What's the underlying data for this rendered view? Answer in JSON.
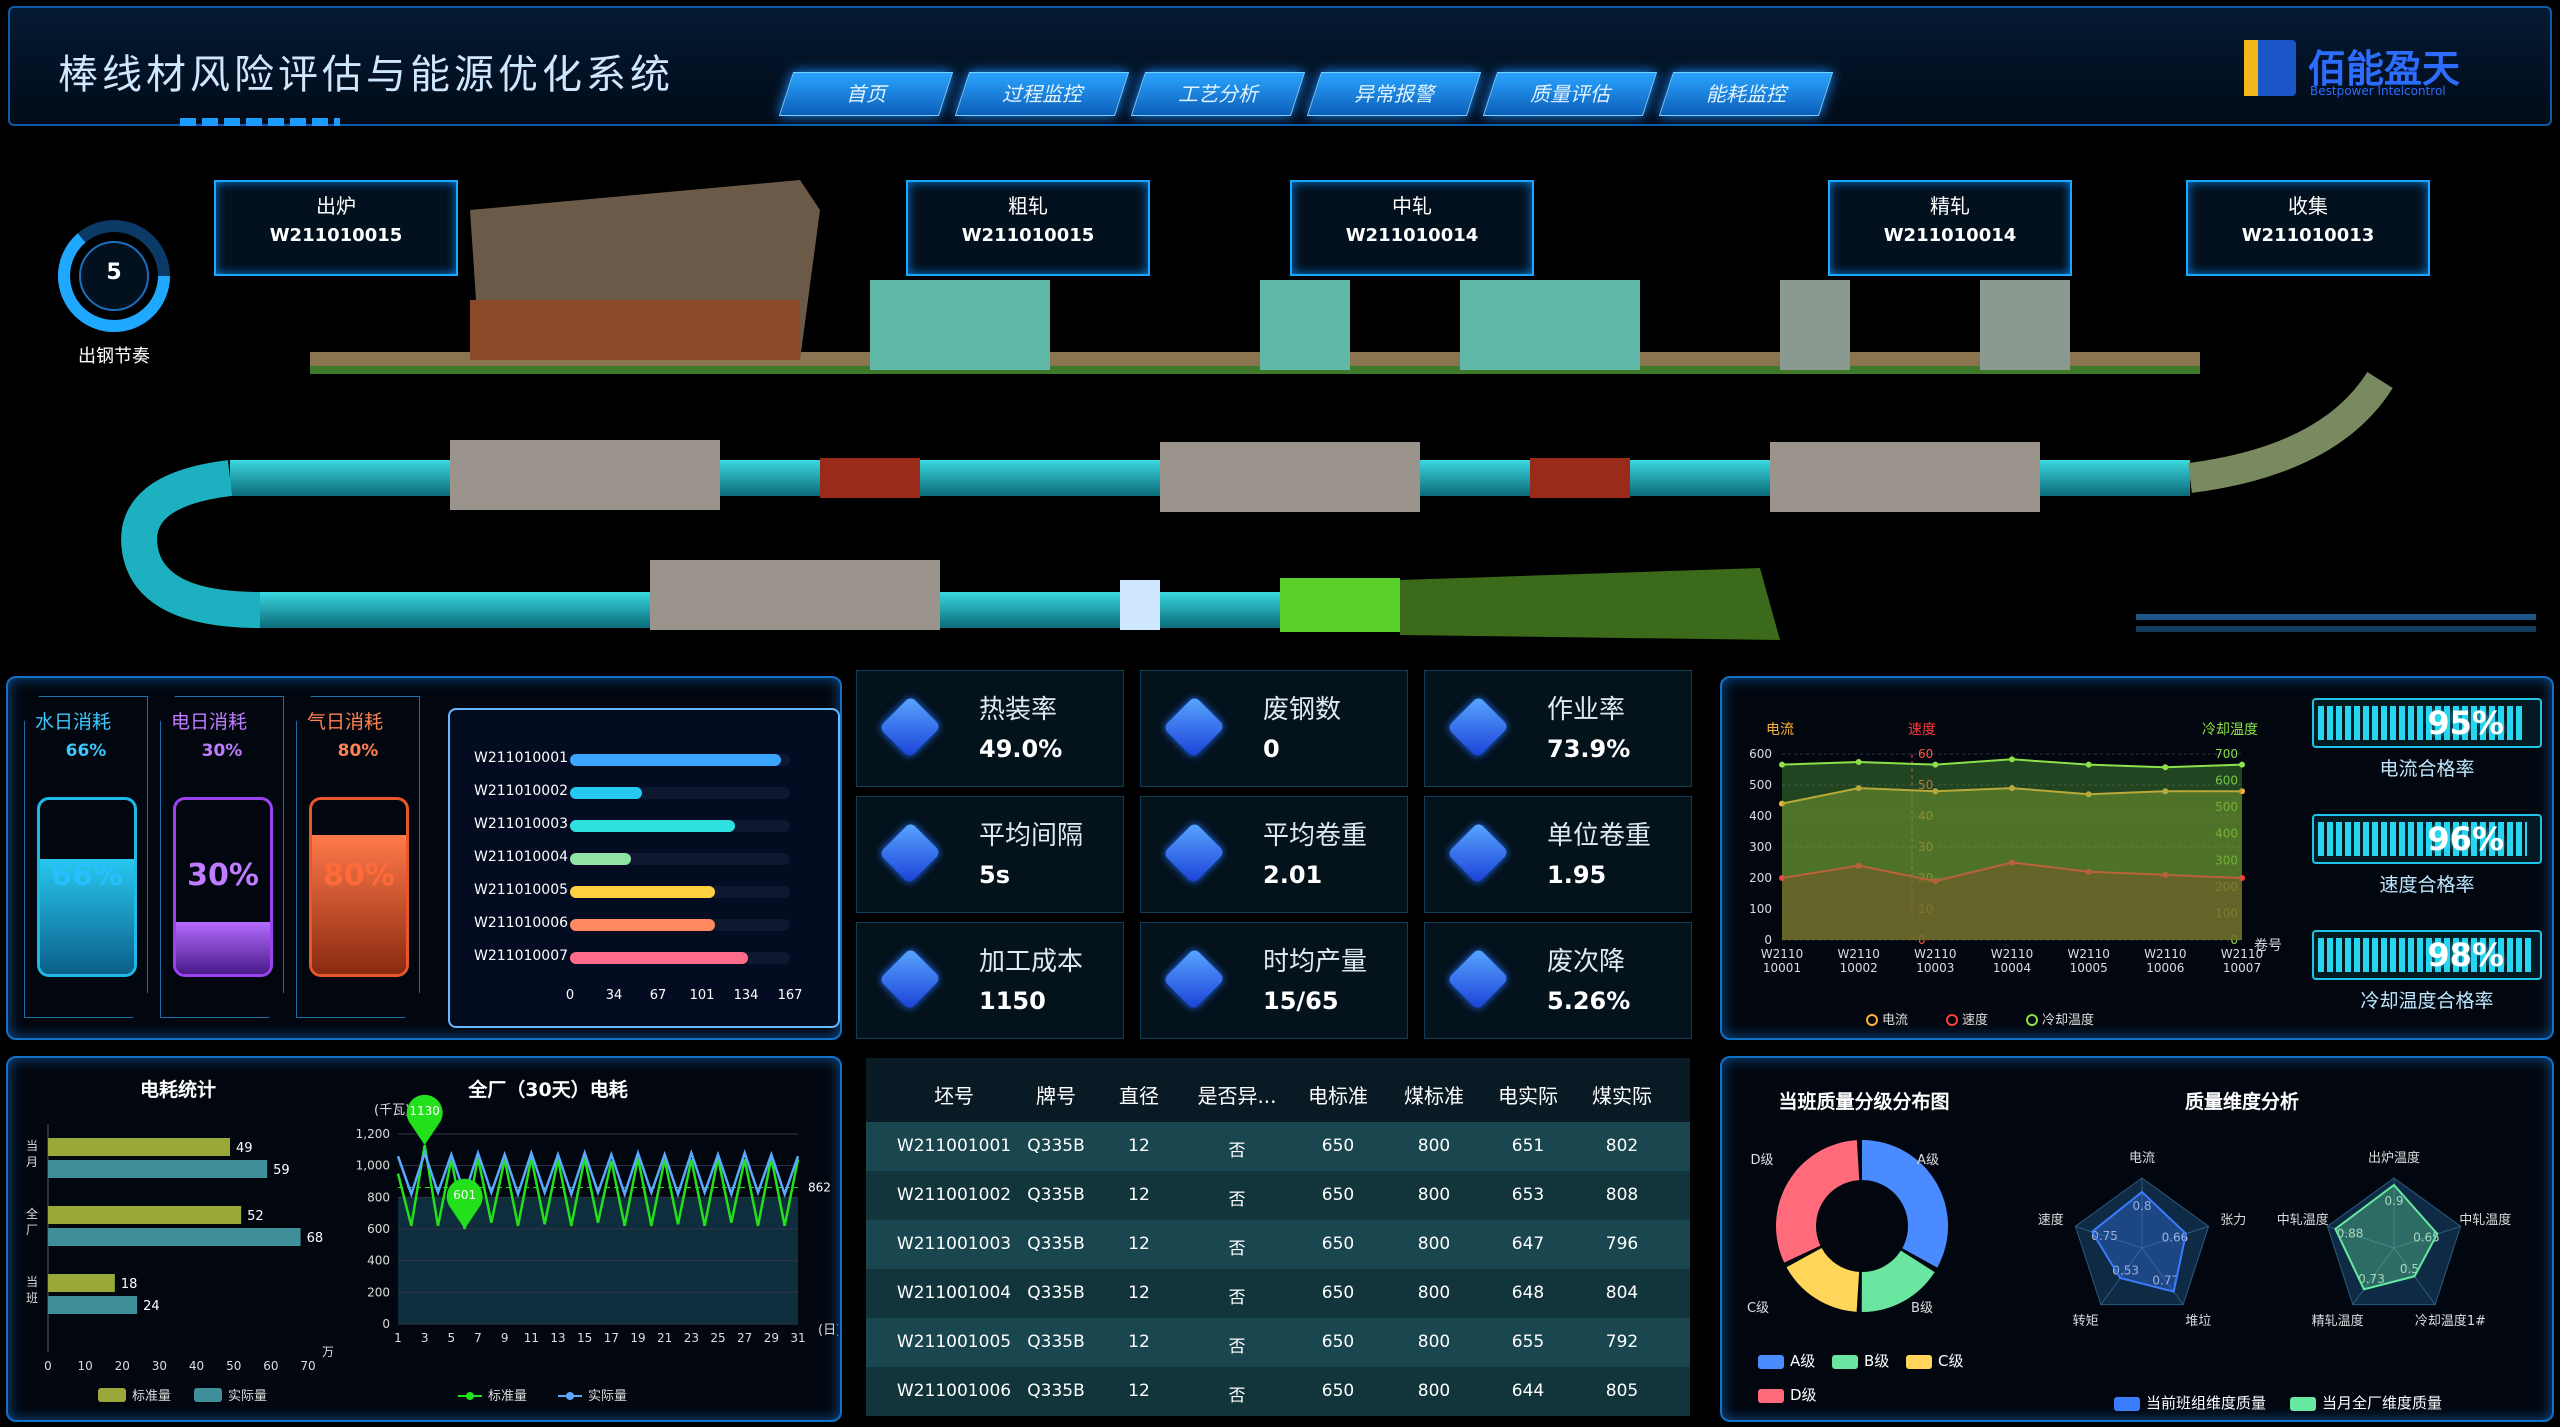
{
  "header": {
    "title": "棒线材风险评估与能源优化系统",
    "nav": [
      "首页",
      "过程监控",
      "工艺分析",
      "异常报警",
      "质量评估",
      "能耗监控"
    ],
    "logo_name": "佰能盈天",
    "logo_sub": "Bestpower Intelcontrol"
  },
  "rhythm": {
    "value": "5",
    "label": "出钢节奏"
  },
  "stations": [
    {
      "name": "出炉",
      "code": "W211010015"
    },
    {
      "name": "粗轧",
      "code": "W211010015"
    },
    {
      "name": "中轧",
      "code": "W211010014"
    },
    {
      "name": "精轧",
      "code": "W211010014"
    },
    {
      "name": "收集",
      "code": "W211010013"
    }
  ],
  "consumption": [
    {
      "title": "水日消耗",
      "pct": "66%",
      "fraction": 0.66,
      "color": "#20b8e6"
    },
    {
      "title": "电日消耗",
      "pct": "30%",
      "fraction": 0.3,
      "color": "#9b42f0"
    },
    {
      "title": "气日消耗",
      "pct": "80%",
      "fraction": 0.8,
      "color": "#e6572c"
    }
  ],
  "billets": {
    "items": [
      {
        "code": "W211010001",
        "value": 160,
        "color": "#3aa6ff"
      },
      {
        "code": "W211010002",
        "value": 55,
        "color": "#24c8f0"
      },
      {
        "code": "W211010003",
        "value": 125,
        "color": "#2ee0e0"
      },
      {
        "code": "W211010004",
        "value": 46,
        "color": "#8fe3a4"
      },
      {
        "code": "W211010005",
        "value": 110,
        "color": "#ffd040"
      },
      {
        "code": "W211010006",
        "value": 110,
        "color": "#ff8a60"
      },
      {
        "code": "W211010007",
        "value": 135,
        "color": "#ff6b8a"
      }
    ],
    "ticks": [
      "0",
      "34",
      "67",
      "101",
      "134",
      "167"
    ],
    "max": 167
  },
  "kpis": [
    {
      "title": "热装率",
      "value": "49.0%"
    },
    {
      "title": "废钢数",
      "value": "0"
    },
    {
      "title": "作业率",
      "value": "73.9%"
    },
    {
      "title": "平均间隔",
      "value": "5s"
    },
    {
      "title": "平均卷重",
      "value": "2.01"
    },
    {
      "title": "单位卷重",
      "value": "1.95"
    },
    {
      "title": "加工成本",
      "value": "1150"
    },
    {
      "title": "时均产量",
      "value": "15/65"
    },
    {
      "title": "废次降",
      "value": "5.26%"
    }
  ],
  "gauges": [
    {
      "value": "95%",
      "fraction": 0.95,
      "label": "电流合格率"
    },
    {
      "value": "96%",
      "fraction": 0.96,
      "label": "速度合格率"
    },
    {
      "value": "98%",
      "fraction": 0.98,
      "label": "冷却温度合格率"
    }
  ],
  "electricity_table": {
    "headers": [
      "坯号",
      "牌号",
      "直径",
      "是否异...",
      "电标准",
      "煤标准",
      "电实际",
      "煤实际"
    ],
    "rows": [
      [
        "W211001001",
        "Q335B",
        "12",
        "否",
        "650",
        "800",
        "651",
        "802"
      ],
      [
        "W211001002",
        "Q335B",
        "12",
        "否",
        "650",
        "800",
        "653",
        "808"
      ],
      [
        "W211001003",
        "Q335B",
        "12",
        "否",
        "650",
        "800",
        "647",
        "796"
      ],
      [
        "W211001004",
        "Q335B",
        "12",
        "否",
        "650",
        "800",
        "648",
        "804"
      ],
      [
        "W211001005",
        "Q335B",
        "12",
        "否",
        "650",
        "800",
        "655",
        "792"
      ],
      [
        "W211001006",
        "Q335B",
        "12",
        "否",
        "650",
        "800",
        "644",
        "805"
      ]
    ]
  },
  "chart_data": [
    {
      "type": "area",
      "title": "",
      "axis_left_label": "电流",
      "axis_mid_label": "速度",
      "axis_right_label": "冷却温度",
      "xlabel": "卷号",
      "categories": [
        "W2110\n10001",
        "W2110\n10002",
        "W2110\n10003",
        "W2110\n10004",
        "W2110\n10005",
        "W2110\n10006",
        "W2110\n10007"
      ],
      "y_left_ticks": [
        "0",
        "100",
        "200",
        "300",
        "400",
        "500",
        "600"
      ],
      "y_mid_ticks": [
        "0",
        "10",
        "20",
        "30",
        "40",
        "50",
        "60"
      ],
      "y_right_ticks": [
        "0",
        "100",
        "200",
        "300",
        "400",
        "500",
        "600",
        "700"
      ],
      "ylim_left": [
        0,
        600
      ],
      "ylim_right": [
        0,
        700
      ],
      "series": [
        {
          "name": "电流",
          "color": "#ffb03a",
          "axis": "left",
          "values": [
            440,
            490,
            480,
            490,
            470,
            480,
            480
          ]
        },
        {
          "name": "速度",
          "color": "#ff3a3a",
          "axis": "mid",
          "values": [
            200,
            240,
            190,
            250,
            220,
            210,
            200
          ]
        },
        {
          "name": "冷却温度",
          "color": "#8ee04a",
          "axis": "right",
          "values": [
            660,
            670,
            660,
            680,
            660,
            650,
            660
          ]
        }
      ]
    },
    {
      "type": "bar",
      "title": "电耗统计",
      "orientation": "horizontal",
      "categories": [
        "当月",
        "全厂",
        "当班"
      ],
      "x_ticks": [
        "0",
        "10",
        "20",
        "30",
        "40",
        "50",
        "60",
        "70"
      ],
      "xlim": [
        0,
        70
      ],
      "xunit": "万",
      "series": [
        {
          "name": "标准量",
          "color": "#9aa83a",
          "values": [
            49,
            52,
            18
          ]
        },
        {
          "name": "实际量",
          "color": "#3f8f9a",
          "values": [
            59,
            68,
            24
          ]
        }
      ]
    },
    {
      "type": "line",
      "title": "全厂（30天）电耗",
      "ylabel": "(千瓦)",
      "xlabel": "(日)",
      "y_ticks": [
        "0",
        "200",
        "400",
        "600",
        "800",
        "1,000",
        "1,200"
      ],
      "ylim": [
        0,
        1200
      ],
      "x_ticks": [
        "1",
        "3",
        "5",
        "7",
        "9",
        "11",
        "13",
        "15",
        "17",
        "19",
        "21",
        "23",
        "25",
        "27",
        "29",
        "31"
      ],
      "markers": {
        "max": "1130",
        "min": "601",
        "avg": "862"
      },
      "series": [
        {
          "name": "标准量",
          "color": "#22e01a",
          "values": [
            950,
            620,
            1130,
            620,
            1040,
            600,
            1050,
            640,
            1040,
            620,
            1050,
            630,
            1040,
            620,
            1050,
            640,
            1030,
            620,
            1050,
            620,
            1040,
            630,
            1040,
            620,
            1050,
            640,
            1040,
            620,
            1050,
            620,
            1040
          ]
        },
        {
          "name": "实际量",
          "color": "#5aa8ff",
          "values": [
            1060,
            820,
            1080,
            830,
            1070,
            820,
            1080,
            830,
            1070,
            820,
            1080,
            830,
            1070,
            820,
            1080,
            830,
            1070,
            820,
            1080,
            830,
            1070,
            820,
            1080,
            830,
            1070,
            820,
            1080,
            830,
            1070,
            820,
            1060
          ]
        }
      ]
    },
    {
      "type": "pie",
      "title": "当班质量分级分布图",
      "series": [
        {
          "name": "A级",
          "color": "#4a8cff",
          "value": 34
        },
        {
          "name": "B级",
          "color": "#6be6a0",
          "value": 17
        },
        {
          "name": "C级",
          "color": "#ffd65a",
          "value": 17
        },
        {
          "name": "D级",
          "color": "#ff6b7a",
          "value": 32
        }
      ]
    },
    {
      "type": "radar",
      "title": "质量维度分析",
      "radar_left": {
        "axes": [
          "电流",
          "张力",
          "堆垃",
          "转矩",
          "速度"
        ],
        "values": [
          0.8,
          0.66,
          0.77,
          0.53,
          0.75
        ]
      },
      "radar_right": {
        "axes": [
          "出炉温度",
          "中轧温度",
          "冷却温度1#",
          "精轧温度",
          "中轧温度"
        ],
        "values": [
          0.9,
          0.65,
          0.5,
          0.73,
          0.88
        ]
      },
      "series": [
        {
          "name": "当前班组维度质量",
          "color": "#3a7cff"
        },
        {
          "name": "当月全厂维度质量",
          "color": "#66e8a0"
        }
      ]
    }
  ]
}
